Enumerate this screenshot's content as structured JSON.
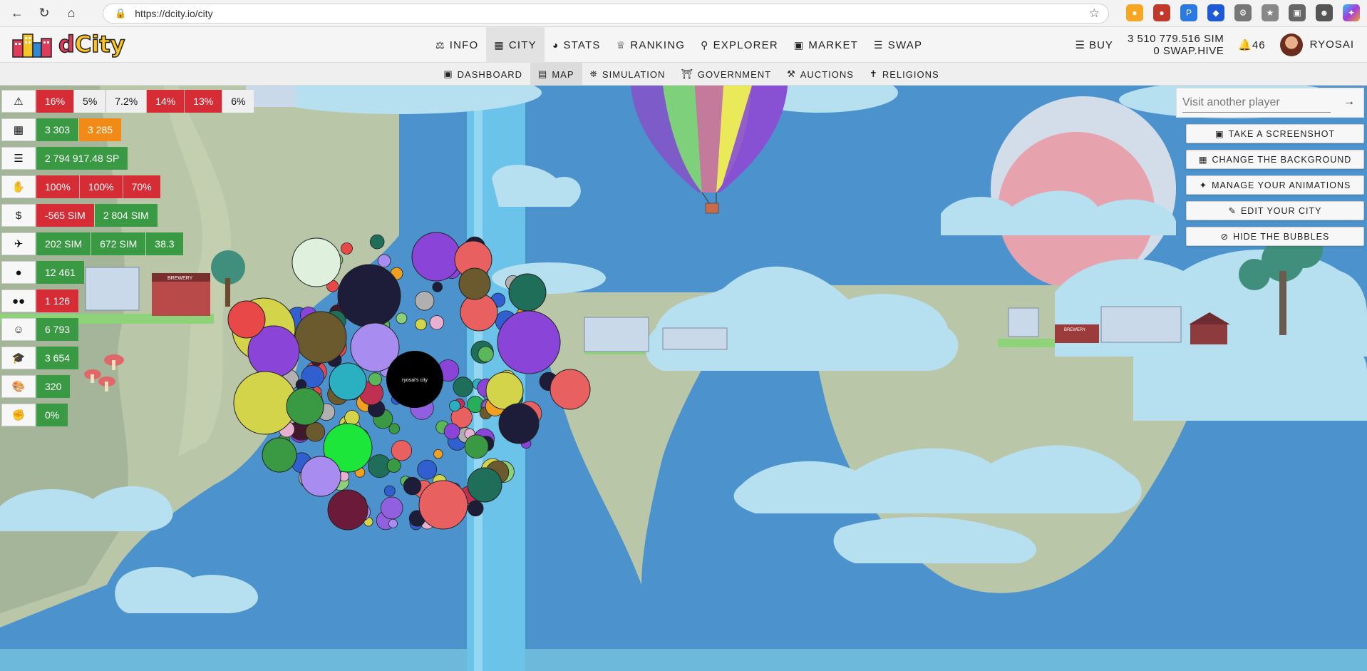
{
  "browser": {
    "url": "https://dcity.io/city"
  },
  "header": {
    "logo_text": "dCity",
    "nav": [
      {
        "label": "INFO",
        "icon": "balance-scale-icon"
      },
      {
        "label": "CITY",
        "icon": "city-icon"
      },
      {
        "label": "STATS",
        "icon": "pie-chart-icon"
      },
      {
        "label": "RANKING",
        "icon": "trophy-icon"
      },
      {
        "label": "EXPLORER",
        "icon": "search-icon"
      },
      {
        "label": "MARKET",
        "icon": "cart-icon"
      },
      {
        "label": "SWAP",
        "icon": "coins-icon"
      }
    ],
    "buy_label": "BUY",
    "balance_sim": "3 510 779.516 SIM",
    "balance_swap": "0 SWAP.HIVE",
    "notifications": "46",
    "username": "RYOSAI"
  },
  "subnav": [
    {
      "label": "DASHBOARD",
      "icon": "dashboard-icon"
    },
    {
      "label": "MAP",
      "icon": "map-icon"
    },
    {
      "label": "SIMULATION",
      "icon": "running-icon"
    },
    {
      "label": "GOVERNMENT",
      "icon": "landmark-icon"
    },
    {
      "label": "AUCTIONS",
      "icon": "auction-icon"
    },
    {
      "label": "RELIGIONS",
      "icon": "pray-icon"
    }
  ],
  "stats": {
    "risks": [
      "16%",
      "5%",
      "7.2%",
      "14%",
      "13%",
      "6%"
    ],
    "buildings": [
      "3 303",
      "3 285"
    ],
    "sp": "2 794 917.48 SP",
    "services": [
      "100%",
      "100%",
      "70%"
    ],
    "income": [
      "-565 SIM",
      "2 804 SIM"
    ],
    "tourism": [
      "202 SIM",
      "672 SIM",
      "38.3"
    ],
    "population": "12 461",
    "unemployed": "1 126",
    "happiness": "6 793",
    "education": "3 654",
    "creativity": "320",
    "other": "0%"
  },
  "right_panel": {
    "visit_placeholder": "Visit another player",
    "actions": [
      {
        "label": "TAKE A SCREENSHOT",
        "icon": "camera-icon"
      },
      {
        "label": "CHANGE THE BACKGROUND",
        "icon": "image-icon"
      },
      {
        "label": "MANAGE YOUR ANIMATIONS",
        "icon": "magic-wand-icon"
      },
      {
        "label": "EDIT YOUR CITY",
        "icon": "edit-icon"
      },
      {
        "label": "HIDE THE BUBBLES",
        "icon": "eye-slash-icon"
      }
    ]
  },
  "city": {
    "center_label": "ryosai's city"
  },
  "colors": {
    "red": "#d62c35",
    "green": "#3a9a44",
    "orange": "#f18a17",
    "sky": "#4c93cd"
  }
}
